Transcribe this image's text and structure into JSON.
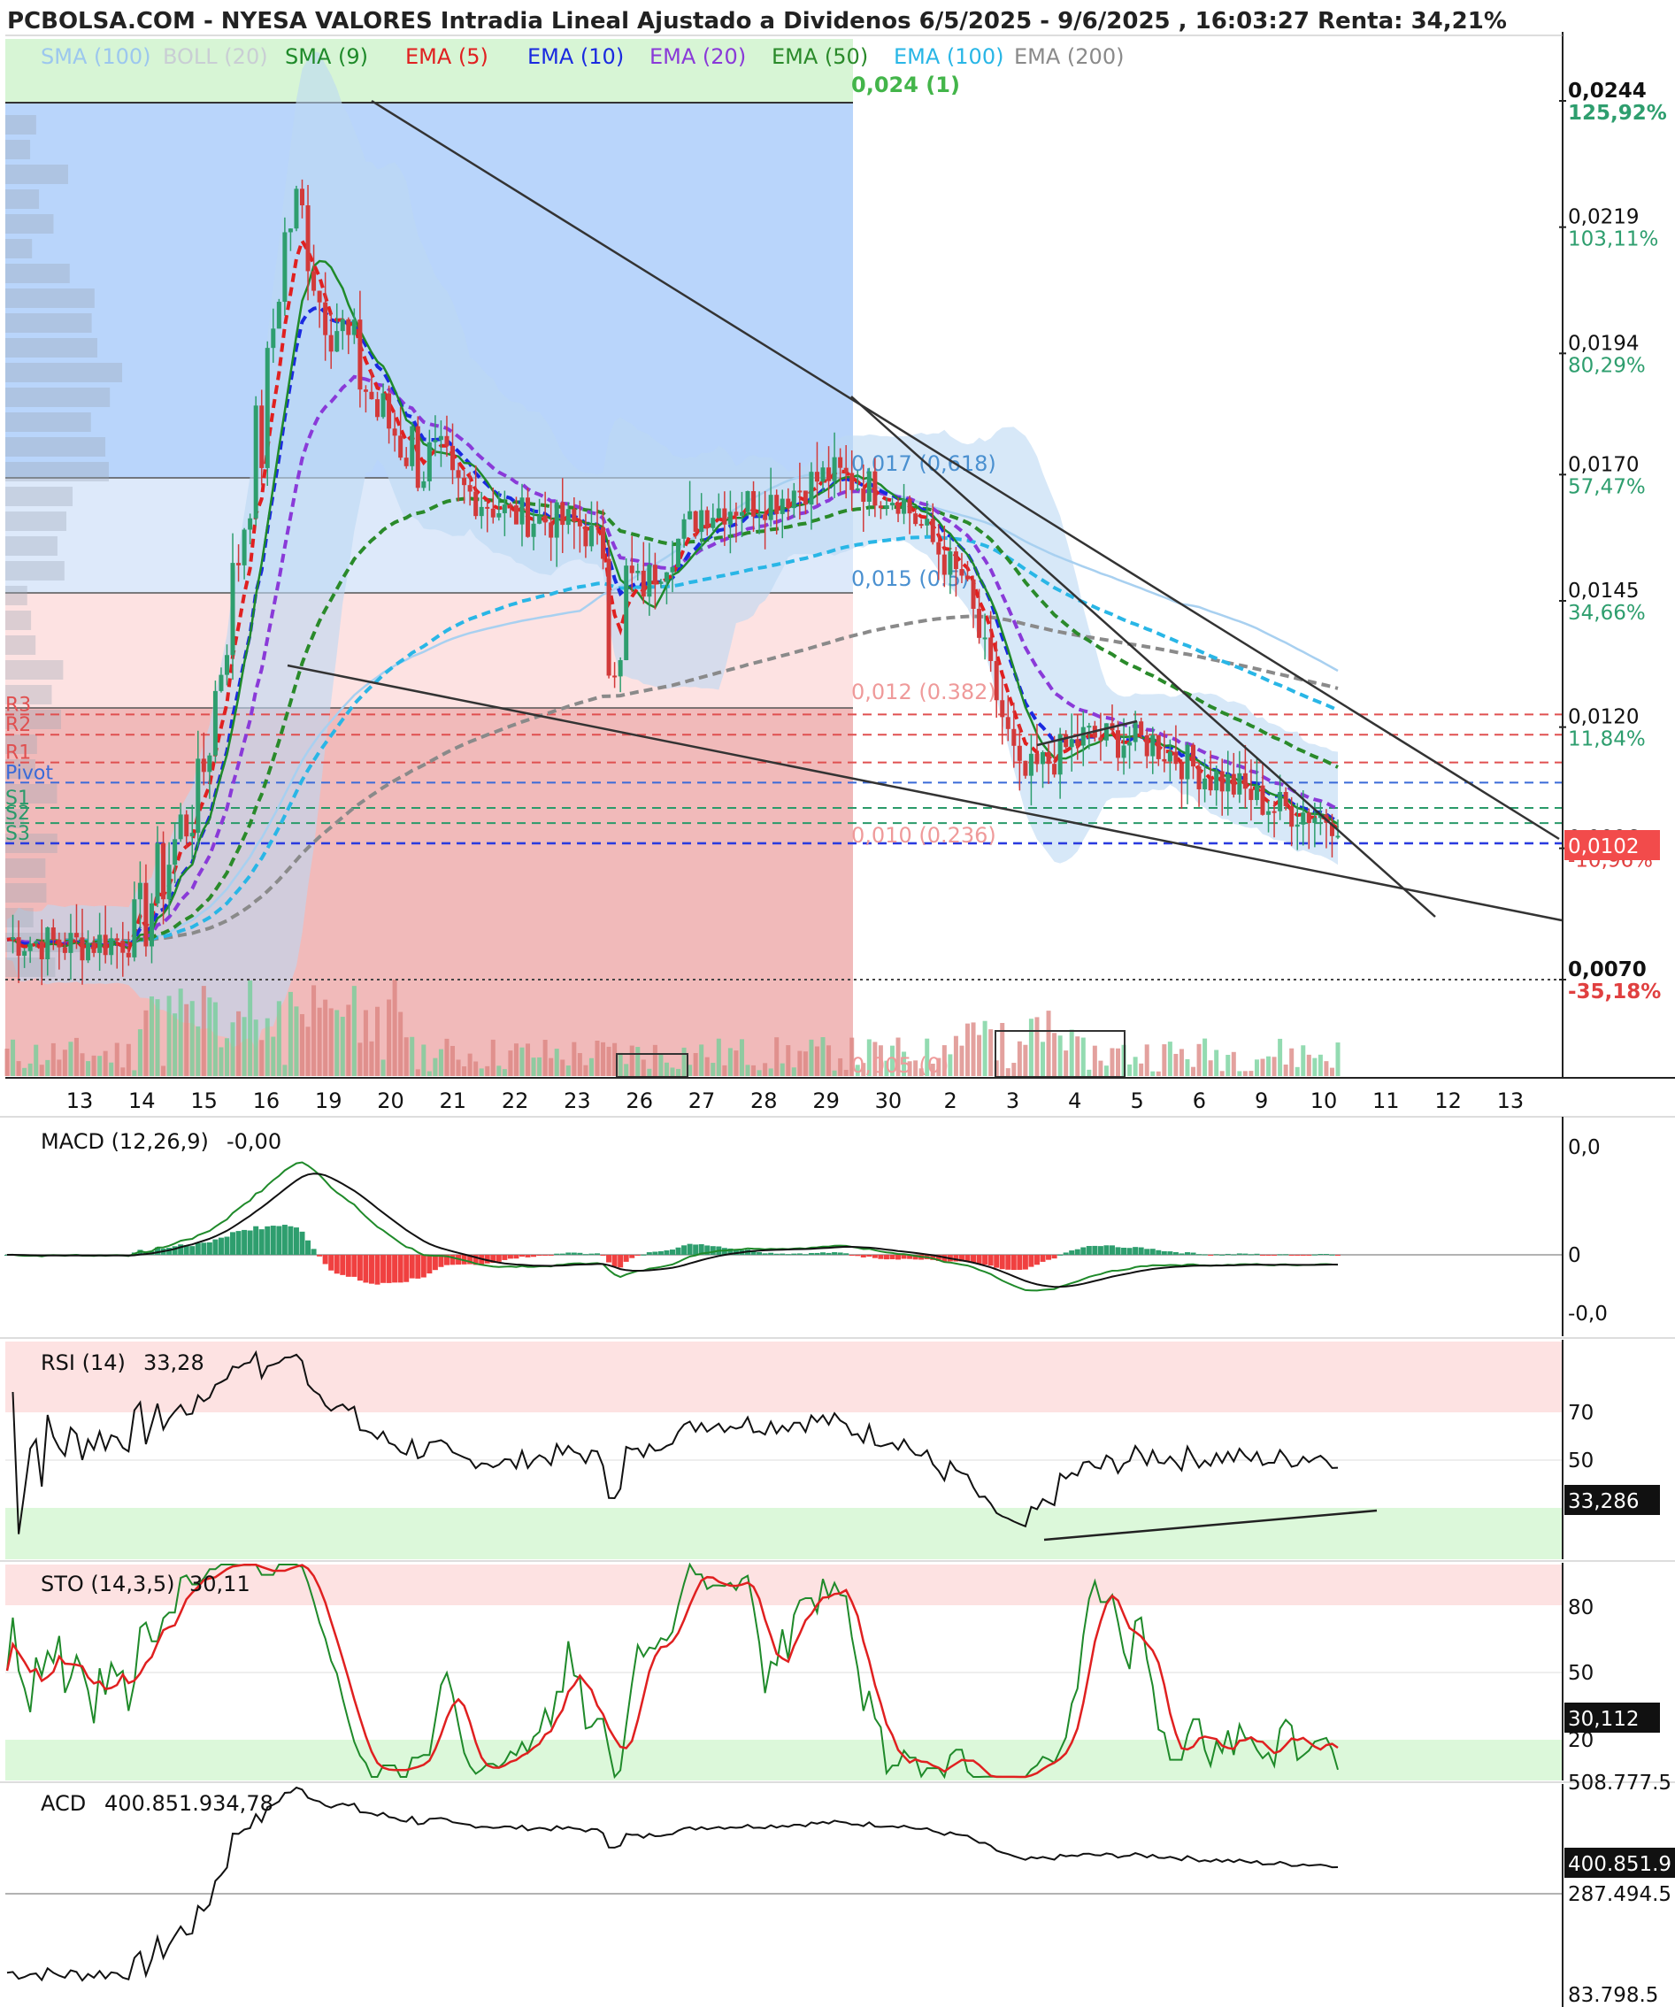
{
  "title": "PCBOLSA.COM - NYESA VALORES Intradia Lineal Ajustado a Dividenos 6/5/2025 - 9/6/2025 , 16:03:27 Renta: 34,21%",
  "colors": {
    "up": "#2e9e6e",
    "down": "#d23a3a",
    "sma9": "#1f8a2a",
    "ema5": "#e02020",
    "ema10": "#1a2ae0",
    "ema20": "#8a3ad8",
    "ema50": "#2a8a2a",
    "ema100": "#29b6e6",
    "ema200": "#8a8a8a",
    "sma100": "#a8d0f0",
    "boll": "#bcd8f4"
  },
  "legend": [
    {
      "label": "SMA (100)",
      "color": "#a8d0f0"
    },
    {
      "label": "BOLL (20)",
      "color": "#d8dde2"
    },
    {
      "label": "SMA (9)",
      "color": "#1f8a2a"
    },
    {
      "label": "EMA (5)",
      "color": "#e02020"
    },
    {
      "label": "EMA (10)",
      "color": "#1a2ae0"
    },
    {
      "label": "EMA (20)",
      "color": "#8a3ad8"
    },
    {
      "label": "EMA (50)",
      "color": "#2a8a2a"
    },
    {
      "label": "EMA (100)",
      "color": "#29b6e6"
    },
    {
      "label": "EMA (200)",
      "color": "#8a8a8a"
    }
  ],
  "price_axis": [
    {
      "price": "0,0244",
      "pct": "125,92%",
      "pct_color": "#2e9e6e",
      "bold": true
    },
    {
      "price": "0,0219",
      "pct": "103,11%",
      "pct_color": "#2e9e6e",
      "bold": false
    },
    {
      "price": "0,0194",
      "pct": "80,29%",
      "pct_color": "#2e9e6e",
      "bold": false
    },
    {
      "price": "0,0170",
      "pct": "57,47%",
      "pct_color": "#2e9e6e",
      "bold": false
    },
    {
      "price": "0,0145",
      "pct": "34,66%",
      "pct_color": "#2e9e6e",
      "bold": false
    },
    {
      "price": "0,0120",
      "pct": "11,84%",
      "pct_color": "#2e9e6e",
      "bold": false
    },
    {
      "price": "0,0096",
      "pct": "-10,96%",
      "pct_color": "#e04040",
      "bold": false
    },
    {
      "price": "0,0070",
      "pct": "-35,18%",
      "pct_color": "#e04040",
      "bold": true
    }
  ],
  "last_price": "0,0102",
  "x_labels": [
    "13",
    "14",
    "15",
    "16",
    "19",
    "20",
    "21",
    "22",
    "23",
    "26",
    "27",
    "28",
    "29",
    "30",
    "2",
    "3",
    "4",
    "5",
    "6",
    "9",
    "10",
    "11",
    "12",
    "13"
  ],
  "fib_levels": [
    {
      "label": "0,024 (1)",
      "price": 0.0244,
      "color": "#43b54a"
    },
    {
      "label": "0,017 (0,618)",
      "price": 0.017,
      "color": "#4a90d0"
    },
    {
      "label": "0,015 (0.5)",
      "price": 0.0148,
      "color": "#4a90d0"
    },
    {
      "label": "0,012 (0.382)",
      "price": 0.0126,
      "color": "#ef9a9a"
    },
    {
      "label": "0,010 (0.236)",
      "price": 0.0101,
      "color": "#ef9a9a"
    },
    {
      "label": "0,005 (0)",
      "price": 0.0052,
      "color": "#ef9a9a"
    }
  ],
  "pivots": [
    {
      "label": "R3",
      "price": 0.01225,
      "color": "#e05050"
    },
    {
      "label": "R2",
      "price": 0.01185,
      "color": "#e05050"
    },
    {
      "label": "R1",
      "price": 0.0113,
      "color": "#e05050"
    },
    {
      "label": "Pivot",
      "price": 0.0109,
      "color": "#3a6ad8"
    },
    {
      "label": "S1",
      "price": 0.0104,
      "color": "#2a9a6a"
    },
    {
      "label": "S2",
      "price": 0.0101,
      "color": "#2a9a6a"
    },
    {
      "label": "S3",
      "price": 0.0097,
      "color": "#2a9a6a"
    }
  ],
  "macd": {
    "label": "MACD (12,26,9)",
    "value": "-0,00",
    "axis": [
      {
        "text": "0,0",
        "color": "#e02020"
      },
      {
        "text": "0",
        "color": "#111111"
      },
      {
        "text": "-0,0",
        "color": "#1f8a2a"
      }
    ]
  },
  "rsi": {
    "label": "RSI (14)",
    "value": "33,28",
    "last": "33,286",
    "axis": [
      {
        "text": "70",
        "color": "#e02020"
      },
      {
        "text": "50",
        "color": "#111111"
      }
    ]
  },
  "sto": {
    "label": "STO (14,3,5)",
    "value": "30,11",
    "last": "30,112",
    "axis": [
      {
        "text": "80",
        "color": "#e02020"
      },
      {
        "text": "50",
        "color": "#111111"
      },
      {
        "text": "20",
        "color": "#1f8a2a"
      }
    ]
  },
  "acd": {
    "label": "ACD",
    "value": "400.851.934,78",
    "last": "400.851.9",
    "axis": [
      {
        "text": "508.777.5",
        "color": "#e02020"
      },
      {
        "text": "287.494.5",
        "color": "#111111"
      },
      {
        "text": "83.798.5",
        "color": "#e02020"
      }
    ]
  },
  "chart_data": {
    "type": "candlestick",
    "title": "PCBOLSA.COM - NYESA VALORES Intradia Lineal Ajustado a Dividenos 6/5/2025 - 9/6/2025 , 16:03:27 Renta: 34,21%",
    "x": [
      "13",
      "14",
      "15",
      "16",
      "19",
      "20",
      "21",
      "22",
      "23",
      "26",
      "27",
      "28",
      "29",
      "30",
      "2",
      "3",
      "4",
      "5",
      "6",
      "9",
      "10"
    ],
    "close": [
      0.0077,
      0.0078,
      0.0105,
      0.0176,
      0.0205,
      0.018,
      0.0168,
      0.0162,
      0.016,
      0.0148,
      0.0163,
      0.0165,
      0.017,
      0.0166,
      0.015,
      0.011,
      0.0118,
      0.0117,
      0.011,
      0.0104,
      0.0102
    ],
    "ylim": [
      0.0055,
      0.026
    ],
    "last_price": 0.0102,
    "indicators": {
      "MACD (12,26,9)": -0.0,
      "RSI (14)": 33.28,
      "STO (14,3,5)": 30.11,
      "ACD": 400851934.78
    }
  }
}
